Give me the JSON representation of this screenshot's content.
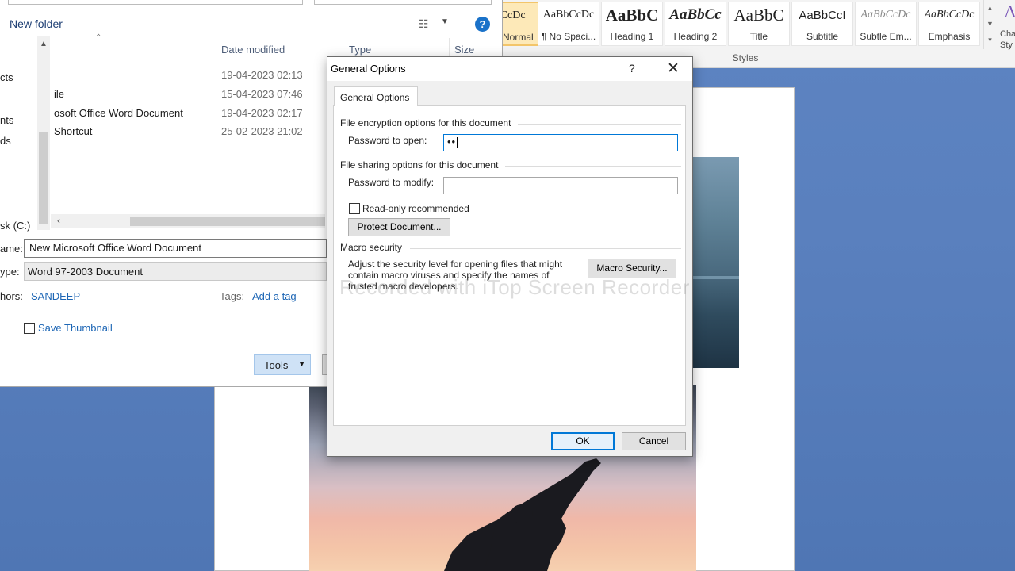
{
  "ribbon": {
    "group_label": "Styles",
    "change_styles_label": "Cha\nSty",
    "styles": [
      {
        "sample": "AaBbCcDc",
        "name": "Normal"
      },
      {
        "sample": "AaBbCcDc",
        "name": "¶ No Spaci..."
      },
      {
        "sample": "AaBbC",
        "name": "Heading 1"
      },
      {
        "sample": "AaBbCc",
        "name": "Heading 2"
      },
      {
        "sample": "AaBbC",
        "name": "Title"
      },
      {
        "sample": "AaBbCcI",
        "name": "Subtitle"
      },
      {
        "sample": "AaBbCcDc",
        "name": "Subtle Em..."
      },
      {
        "sample": "AaBbCcDc",
        "name": "Emphasis"
      }
    ]
  },
  "saveas": {
    "new_folder": "New folder",
    "nav_items": [
      "cts",
      "nts",
      "ds",
      "sk (C:)"
    ],
    "columns": {
      "date_modified": "Date modified",
      "type": "Type",
      "size": "Size"
    },
    "files": [
      {
        "name": "",
        "date": "19-04-2023 02:13"
      },
      {
        "name": "ile",
        "date": "15-04-2023 07:46"
      },
      {
        "name": "osoft Office Word Document",
        "date": "19-04-2023 02:17"
      },
      {
        "name": "Shortcut",
        "date": "25-02-2023 21:02"
      }
    ],
    "file_name_label": "ame:",
    "file_name_value": "New Microsoft Office Word Document",
    "save_type_label": "ype:",
    "save_type_value": "Word 97-2003 Document",
    "authors_label": "hors:",
    "authors_value": "SANDEEP",
    "tags_label": "Tags:",
    "tags_value": "Add a tag",
    "save_thumbnail": "Save Thumbnail",
    "tools_label": "Tools"
  },
  "dialog": {
    "title": "General Options",
    "help": "?",
    "close": "✕",
    "tab": "General Options",
    "encryption_group": "File encryption options for this document",
    "password_open_label": "Password to open:",
    "password_open_value": "••",
    "sharing_group": "File sharing options for this document",
    "password_modify_label": "Password to modify:",
    "password_modify_value": "",
    "readonly_label": "Read-only recommended",
    "protect_button": "Protect Document...",
    "macro_group": "Macro security",
    "macro_text": "Adjust the security level for opening files that might contain macro viruses and specify the names of trusted macro developers.",
    "macro_button": "Macro Security...",
    "ok": "OK",
    "cancel": "Cancel"
  },
  "watermark": "Recorded with iTop Screen Recorder"
}
